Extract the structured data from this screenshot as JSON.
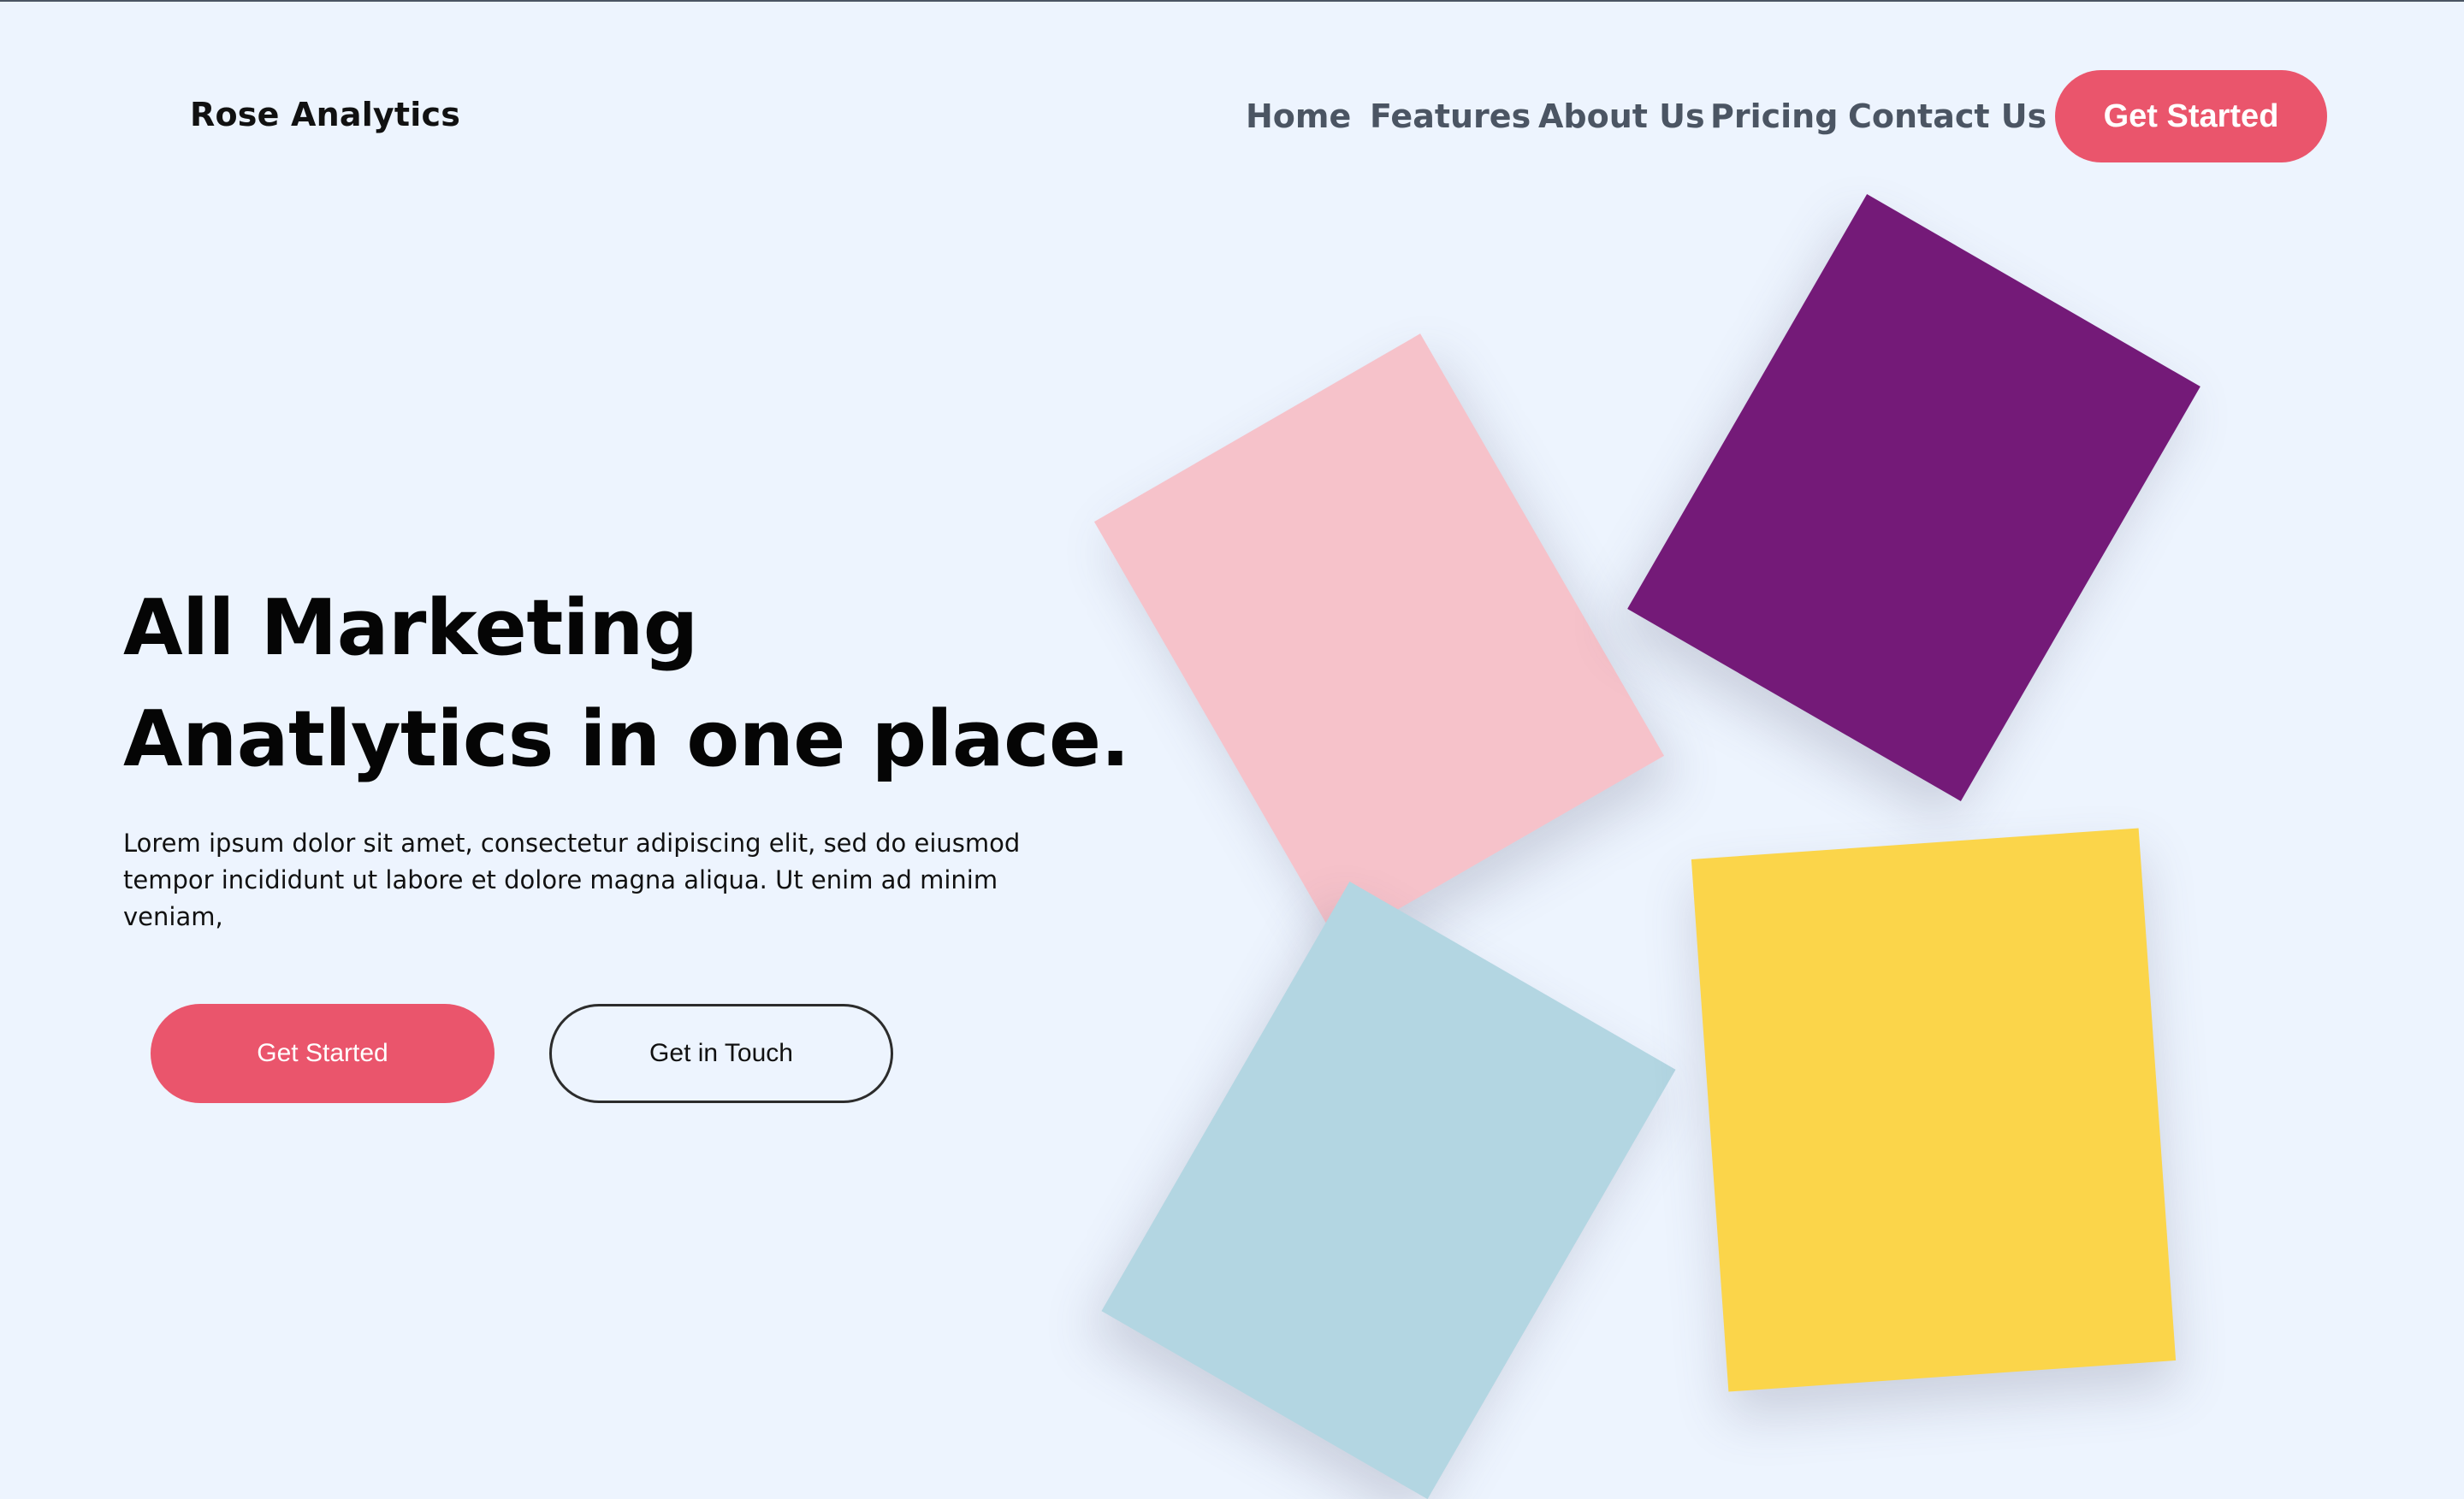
{
  "header": {
    "brand": "Rose Analytics",
    "nav": [
      "Home",
      "Features",
      "About Us",
      "Pricing",
      "Contact Us"
    ],
    "cta_label": "Get Started"
  },
  "hero": {
    "title_line1": "All Marketing",
    "title_line2": "Anatlytics in one place.",
    "description": "Lorem ipsum dolor sit amet, consectetur adipiscing elit, sed do eiusmod tempor incididunt ut labore et dolore magna aliqua. Ut enim ad minim veniam,",
    "primary_label": "Get Started",
    "secondary_label": "Get in Touch"
  },
  "colors": {
    "accent": "#ea556c",
    "background": "#edf4fe",
    "card_pink": "#f6c2ca",
    "card_purple": "#741a78",
    "card_blue": "#b3d6e2",
    "card_yellow": "#fbd54a"
  }
}
